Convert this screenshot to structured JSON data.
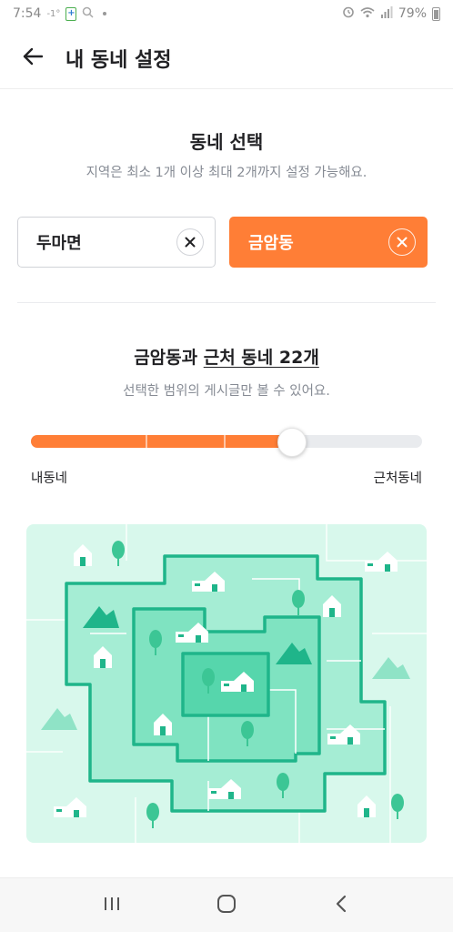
{
  "status_bar": {
    "time": "7:54",
    "temp": "-1°",
    "battery": "79%",
    "icons": [
      "clipboard-icon",
      "search-icon",
      "dot-icon",
      "alarm-icon",
      "wifi-icon",
      "signal-icon",
      "battery-icon"
    ]
  },
  "header": {
    "title": "내 동네 설정",
    "back_icon": "arrow-left-icon"
  },
  "neighborhood_select": {
    "title": "동네 선택",
    "subtitle": "지역은 최소 1개 이상 최대 2개까지 설정 가능해요.",
    "chips": [
      {
        "label": "두마면",
        "selected": false,
        "remove_icon": "close-icon"
      },
      {
        "label": "금암동",
        "selected": true,
        "remove_icon": "close-icon"
      }
    ]
  },
  "range": {
    "title_prefix": "금암동과 ",
    "title_emph": "근처 동네 22개",
    "subtitle": "선택한 범위의 게시글만 볼 수 있어요.",
    "slider_level": 3,
    "slider_max": 4,
    "label_min": "내동네",
    "label_max": "근처동네"
  },
  "map_illustration": {
    "icons": [
      "house-icon",
      "tree-icon",
      "mountain-icon"
    ],
    "colors": {
      "background": "#d8f8ec",
      "layer1": "#a5edd4",
      "layer2": "#7fe3c1",
      "layer3": "#56d6ac",
      "border": "#1fb58a",
      "house": "#ffffff",
      "tree": "#3cc695"
    }
  },
  "colors": {
    "accent": "#ff7e36",
    "text": "#212124",
    "subtext": "#868b94",
    "border": "#d1d3d8"
  },
  "nav_bar": {
    "icons": [
      "recent-apps-icon",
      "home-icon",
      "back-icon"
    ]
  }
}
